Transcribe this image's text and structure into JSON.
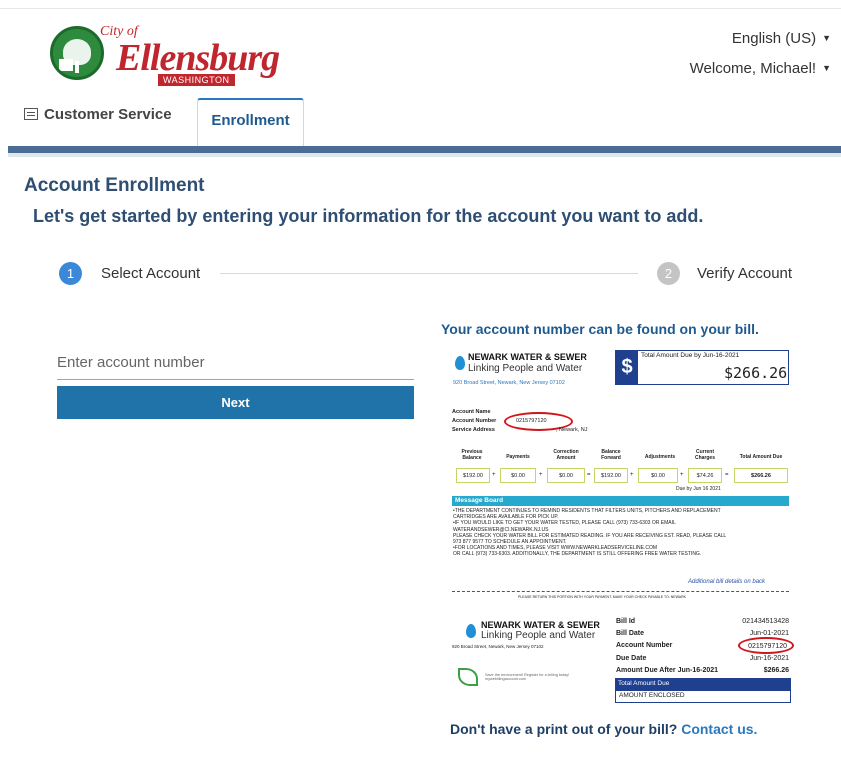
{
  "logo": {
    "city_of": "City of",
    "name": "Ellensburg",
    "state": "WASHINGTON"
  },
  "header": {
    "language": "English (US)",
    "welcome": "Welcome, Michael!"
  },
  "tabs": {
    "customer_service": "Customer Service",
    "enrollment": "Enrollment"
  },
  "page": {
    "title": "Account Enrollment",
    "subtitle": "Let's get started by entering your information for the account you want to add."
  },
  "stepper": {
    "step1_number": "1",
    "step1_label": "Select Account",
    "step2_number": "2",
    "step2_label": "Verify Account"
  },
  "form": {
    "account_placeholder": "Enter account number",
    "account_value": "",
    "next_label": "Next"
  },
  "hint": {
    "top": "Your account number can be found on your bill.",
    "bottom_prefix": "Don't have a print out of your bill?",
    "contact_link": "Contact us."
  },
  "bill": {
    "company": "NEWARK WATER & SEWER",
    "tagline": "Linking People and Water",
    "address": "920 Broad Street, Newark, New Jersey 07102",
    "due_label": "Total Amount Due by Jun-16-2021",
    "due_amount": "$266.26",
    "account_name_label": "Account Name",
    "account_number_label": "Account Number",
    "account_number": "0215797120",
    "service_address_label": "Service Address",
    "service_address": ", Newark, NJ",
    "columns": {
      "previous_balance": "Previous Balance",
      "payments": "Payments",
      "correction": "Correction Amount",
      "balance_forward": "Balance Forward",
      "adjustments": "Adjustments",
      "current_charges": "Current Charges",
      "total_due": "Total Amount Due"
    },
    "values": {
      "previous_balance": "$192.00",
      "payments": "$0.00",
      "correction": "$0.00",
      "balance_forward": "$192.00",
      "adjustments": "$0.00",
      "current_charges": "$74.26",
      "total_due": "$266.26"
    },
    "due_by": "Due by Jun 16 2021",
    "message_board_title": "Message Board",
    "message_lines": [
      "•THE DEPARTMENT CONTINUES TO REMIND RESIDENTS THAT FILTERS UNITS, PITCHERS AND REPLACEMENT",
      "CARTRIDGES ARE AVAILABLE FOR PICK UP.",
      "•IF YOU WOULD LIKE TO GET YOUR WATER TESTED, PLEASE CALL (973) 733-6303 OR EMAIL",
      "WATERANDSEWER@CI.NEWARK.NJ.US",
      "PLEASE CHECK YOUR WATER BILL FOR ESTIMATED READING. IF YOU ARE RECEIVING EST. READ, PLEASE CALL",
      "973 877 9577 TO SCHEDULE AN APPOINTMENT.",
      "•FOR LOCATIONS AND TIMES, PLEASE VISIT WWW.NEWARKLEADSERVICELINE.COM",
      "OR CALL (973) 733-6303. ADDITIONALLY, THE DEPARTMENT IS STILL OFFERING FREE WATER TESTING."
    ],
    "additional_details": "Additional bill details on back",
    "return_note": "PLEASE RETURN THIS PORTION WITH YOUR PAYMENT. MAKE YOUR CHECK PAYABLE TO: NEWARK",
    "stub": {
      "bill_id_label": "Bill Id",
      "bill_id": "021434513428",
      "bill_date_label": "Bill Date",
      "bill_date": "Jun-01-2021",
      "account_number_label": "Account Number",
      "account_number": "0215797120",
      "due_date_label": "Due Date",
      "due_date": "Jun-16-2021",
      "after_label": "Amount Due After Jun-16-2021",
      "after_amount": "$266.26",
      "total_label": "Total Amount Due",
      "enclosed_label": "AMOUNT ENCLOSED",
      "eco_text": "Save the environment! Register for e-billing today! mywebillingaccount.com"
    }
  },
  "colors": {
    "primary": "#1f73a8",
    "heading": "#2e4e73",
    "bar": "#4a6d94",
    "logo_red": "#c0262d"
  }
}
